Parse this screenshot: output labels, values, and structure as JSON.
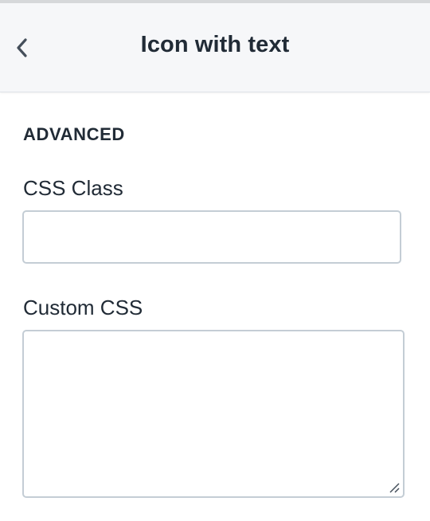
{
  "header": {
    "title": "Icon with text",
    "back_icon": "chevron-left-icon"
  },
  "section": {
    "title": "ADVANCED"
  },
  "fields": {
    "css_class": {
      "label": "CSS Class",
      "value": "",
      "placeholder": ""
    },
    "custom_css": {
      "label": "Custom CSS",
      "value": "",
      "placeholder": ""
    }
  },
  "colors": {
    "text": "#212b36",
    "header_bg": "#f6f7f9",
    "input_border": "#c4cdd5"
  }
}
